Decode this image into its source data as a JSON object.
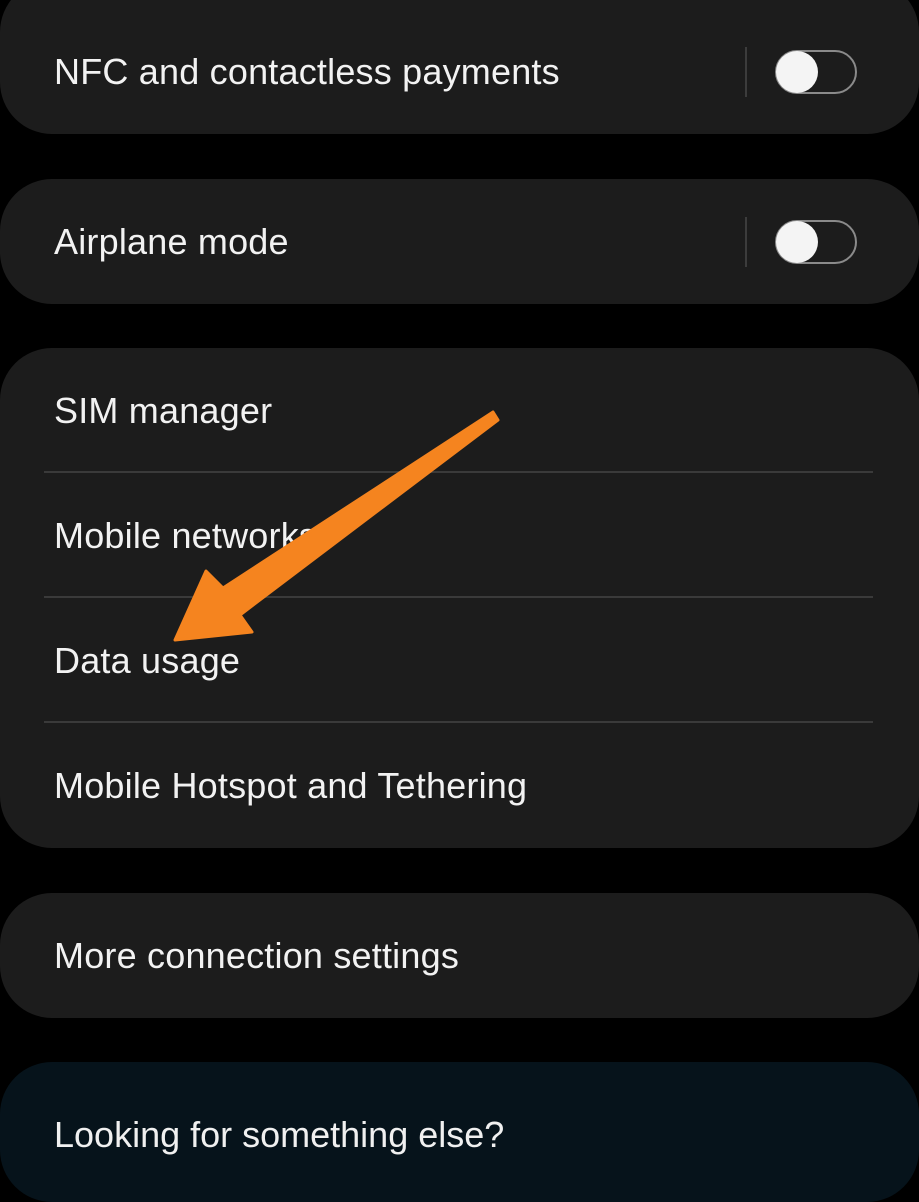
{
  "settings": {
    "nfc": {
      "label": "NFC and contactless payments",
      "enabled": false
    },
    "airplane": {
      "label": "Airplane mode",
      "enabled": false
    },
    "group": [
      {
        "label": "SIM manager"
      },
      {
        "label": "Mobile networks"
      },
      {
        "label": "Data usage"
      },
      {
        "label": "Mobile Hotspot and Tethering"
      }
    ],
    "more": {
      "label": "More connection settings"
    }
  },
  "help": {
    "label": "Looking for something else?"
  },
  "colors": {
    "background": "#000000",
    "card": "#1c1c1c",
    "help_card": "#06131b",
    "annotation_arrow": "#f5841f"
  },
  "icons": {
    "annotation": "arrow-pointer-icon"
  }
}
